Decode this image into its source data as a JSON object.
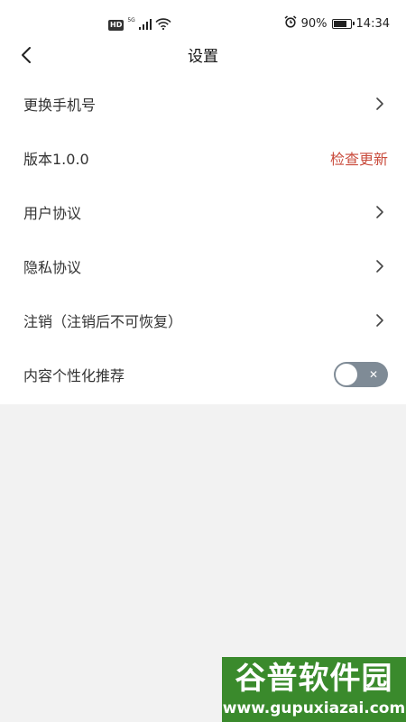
{
  "status_bar": {
    "hd": "HD",
    "network": "5G",
    "battery": "90%",
    "battery_level": 0.9,
    "time": "14:34"
  },
  "header": {
    "title": "设置",
    "back_icon": "chevron-left-icon"
  },
  "settings": {
    "change_phone": "更换手机号",
    "version": "版本1.0.0",
    "check_update": "检查更新",
    "user_agreement": "用户协议",
    "privacy_agreement": "隐私协议",
    "deregister": "注销（注销后不可恢复）",
    "personalized_recommend": "内容个性化推荐",
    "personalized_recommend_enabled": false
  },
  "colors": {
    "accent_update": "#c94b3c",
    "toggle_off": "#7f8b96",
    "page_bg": "#f2f2f2",
    "list_bg": "#ffffff",
    "watermark_bg": "#3a8a2c"
  },
  "watermark": {
    "title": "谷普软件园",
    "url": "www.gupuxiazai.com"
  }
}
